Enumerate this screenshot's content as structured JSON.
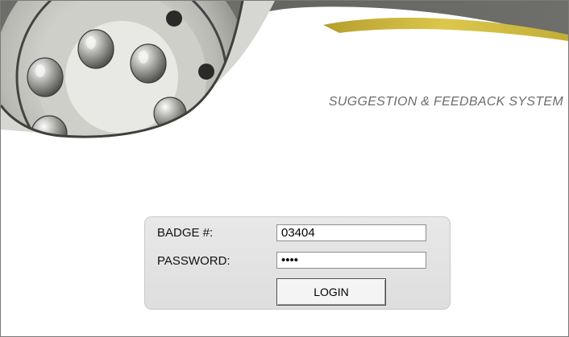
{
  "header": {
    "system_title": "SUGGESTION & FEEDBACK SYSTEM"
  },
  "login": {
    "badge_label": "BADGE #:",
    "badge_value": "03404",
    "password_label": "PASSWORD:",
    "password_value": "••••",
    "login_button_label": "LOGIN"
  },
  "colors": {
    "accent_yellow": "#c9b23a",
    "panel_bg": "#e3e3e3",
    "title_gray": "#6c6c6c"
  }
}
